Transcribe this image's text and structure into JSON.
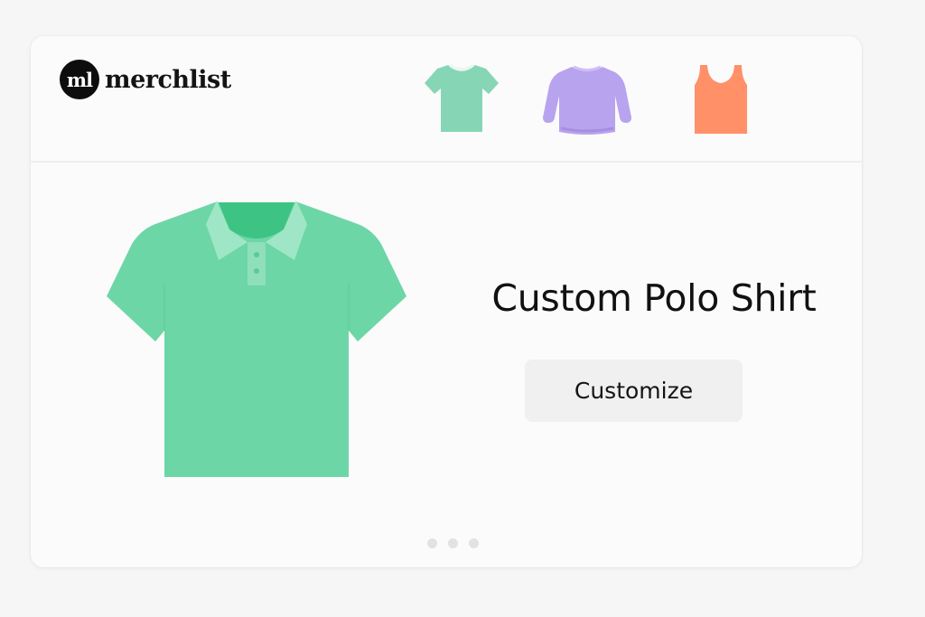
{
  "brand": {
    "mark": "ml",
    "name": "merchlist"
  },
  "thumbnails": [
    {
      "name": "t-shirt",
      "icon": "tshirt-icon",
      "color": "#86d6b6"
    },
    {
      "name": "sweatshirt",
      "icon": "sweatshirt-icon",
      "color": "#b8a3ef"
    },
    {
      "name": "tank top",
      "icon": "tank-top-icon",
      "color": "#ff9068"
    }
  ],
  "product": {
    "title": "Custom Polo Shirt",
    "icon": "polo-shirt-icon",
    "color": "#6dd6a6",
    "collar_color": "#9fe6c6",
    "inner_color": "#3dc484"
  },
  "actions": {
    "customize_label": "Customize"
  },
  "carousel": {
    "count": 3,
    "active_index": 0
  },
  "colors": {
    "dot": "#e2e2e2"
  }
}
